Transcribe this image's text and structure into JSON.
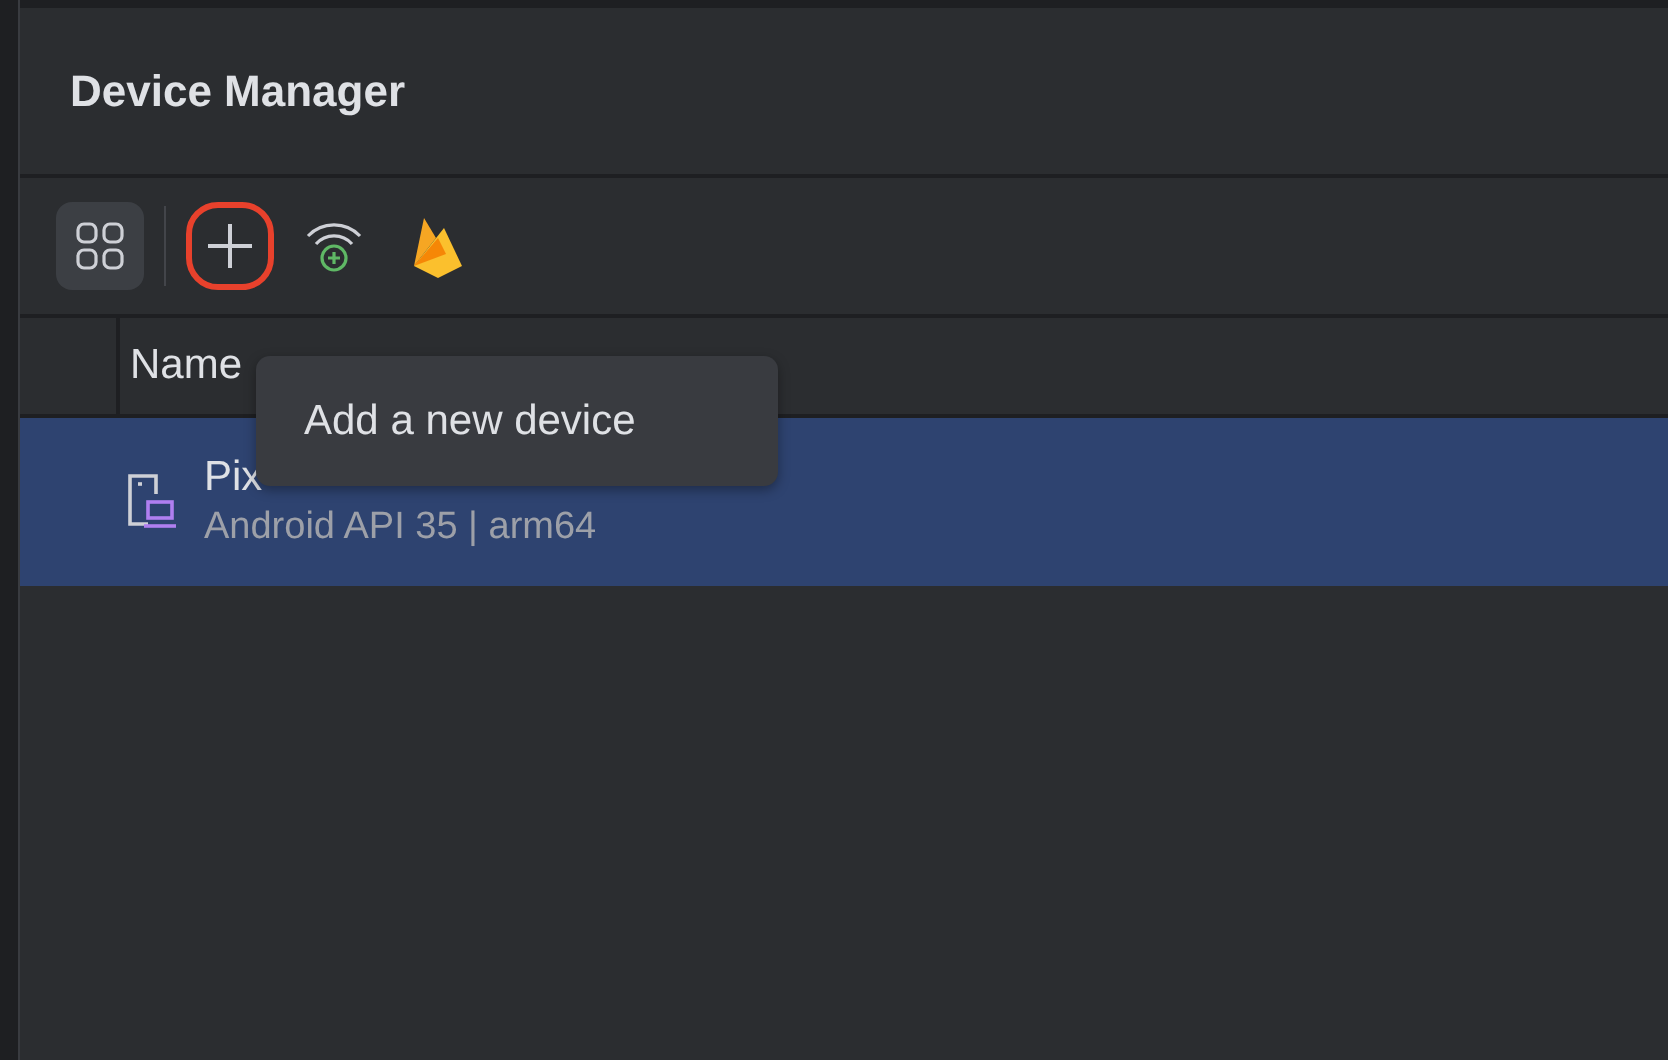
{
  "panel": {
    "title": "Device Manager"
  },
  "toolbar": [
    {
      "kind": "grid",
      "highlighted": false
    },
    {
      "kind": "add",
      "highlighted": true
    },
    {
      "kind": "wifi",
      "highlighted": false
    },
    {
      "kind": "firebase",
      "highlighted": false
    }
  ],
  "table": {
    "columns": [
      "Name"
    ],
    "rows": [
      {
        "name": "Pix",
        "details": "Android API 35 | arm64",
        "selected": true
      }
    ]
  },
  "tooltip": {
    "text": "Add a new device"
  }
}
